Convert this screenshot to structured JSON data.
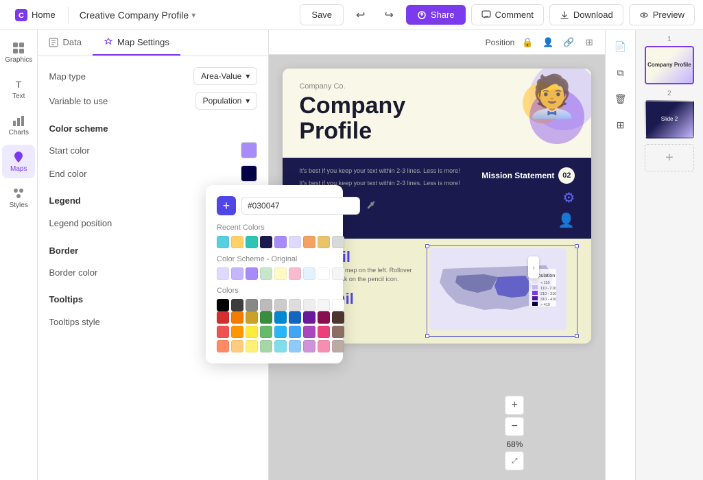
{
  "app": {
    "home_label": "Home",
    "doc_title": "Creative Company Profile",
    "save_label": "Save",
    "share_label": "Share",
    "comment_label": "Comment",
    "download_label": "Download",
    "preview_label": "Preview"
  },
  "sidebar": {
    "items": [
      {
        "id": "graphics",
        "label": "Graphics",
        "icon": "🖼"
      },
      {
        "id": "text",
        "label": "Text",
        "icon": "T"
      },
      {
        "id": "charts",
        "label": "Charts",
        "icon": "📊"
      },
      {
        "id": "maps",
        "label": "Maps",
        "icon": "🗺"
      },
      {
        "id": "styles",
        "label": "Styles",
        "icon": "✦"
      }
    ]
  },
  "panel": {
    "tabs": [
      {
        "id": "data",
        "label": "Data"
      },
      {
        "id": "map_settings",
        "label": "Map Settings"
      }
    ],
    "active_tab": "map_settings",
    "map_type_label": "Map type",
    "map_type_value": "Area-Value",
    "variable_label": "Variable to use",
    "variable_value": "Population",
    "color_scheme_title": "Color scheme",
    "start_color_label": "Start color",
    "start_color_hex": "#a78bfa",
    "end_color_label": "End color",
    "end_color_hex": "#030047",
    "legend_title": "Legend",
    "legend_position_label": "Legend position",
    "legend_position_value": "Right",
    "border_title": "Border",
    "border_color_label": "Border color",
    "tooltips_title": "Tooltips",
    "tooltips_style_label": "Tooltips style",
    "tooltips_style_value": "Light"
  },
  "color_picker": {
    "hex_value": "#030047",
    "recent_colors_title": "Recent Colors",
    "recent_colors": [
      "#56cfe1",
      "#ffd166",
      "#2ec4b6",
      "#1a1a4e",
      "#a78bfa",
      "#e0d9ff",
      "#f4a261",
      "#e9c46a",
      "#d9d9d9"
    ],
    "scheme_title": "Color Scheme - Original",
    "scheme_colors": [
      "#e0d9ff",
      "#c4b5fd",
      "#a78bfa",
      "#c8e6c9",
      "#fff9c4",
      "#f8bbd0",
      "#e3f2fd",
      "#ffffff",
      "#f5f5f5"
    ],
    "colors_title": "Colors",
    "main_colors_row1": [
      "#000000",
      "#3d3d3d",
      "#888888",
      "#bbbbbb",
      "#cccccc",
      "#dddddd",
      "#eeeeee",
      "#f5f5f5",
      "#ffffff"
    ],
    "main_colors_row2": [
      "#d32f2f",
      "#f57c00",
      "#c9a227",
      "#388e3c",
      "#0288d1",
      "#1565c0",
      "#6a1b9a",
      "#880e4f",
      "#4e342e"
    ],
    "main_colors_row3": [
      "#ef5350",
      "#ff9800",
      "#ffeb3b",
      "#66bb6a",
      "#29b6f6",
      "#42a5f5",
      "#ab47bc",
      "#ec407a",
      "#8d6e63"
    ],
    "main_colors_row4": [
      "#ff8a65",
      "#ffcc80",
      "#fff176",
      "#a5d6a7",
      "#80deea",
      "#90caf9",
      "#ce93d8",
      "#f48fb1",
      "#bcaaa4"
    ]
  },
  "canvas": {
    "position_label": "Position",
    "zoom_percent": "68%",
    "slide1": {
      "company": "Company Co.",
      "title_line1": "Company",
      "title_line2": "Profile",
      "mission_title": "Mission Statement",
      "mission_num": "02",
      "mission_text": "It's best if you keep your text within 2-3 lines. Less is more!",
      "stat1": "$10 mil",
      "stat1_desc": "You can edit the map on the left. Rollover the map and click on the pencil icon.",
      "stat2": "↑ 15 mil"
    }
  },
  "pages": [
    {
      "num": "1",
      "active": true
    },
    {
      "num": "2",
      "active": false
    }
  ]
}
